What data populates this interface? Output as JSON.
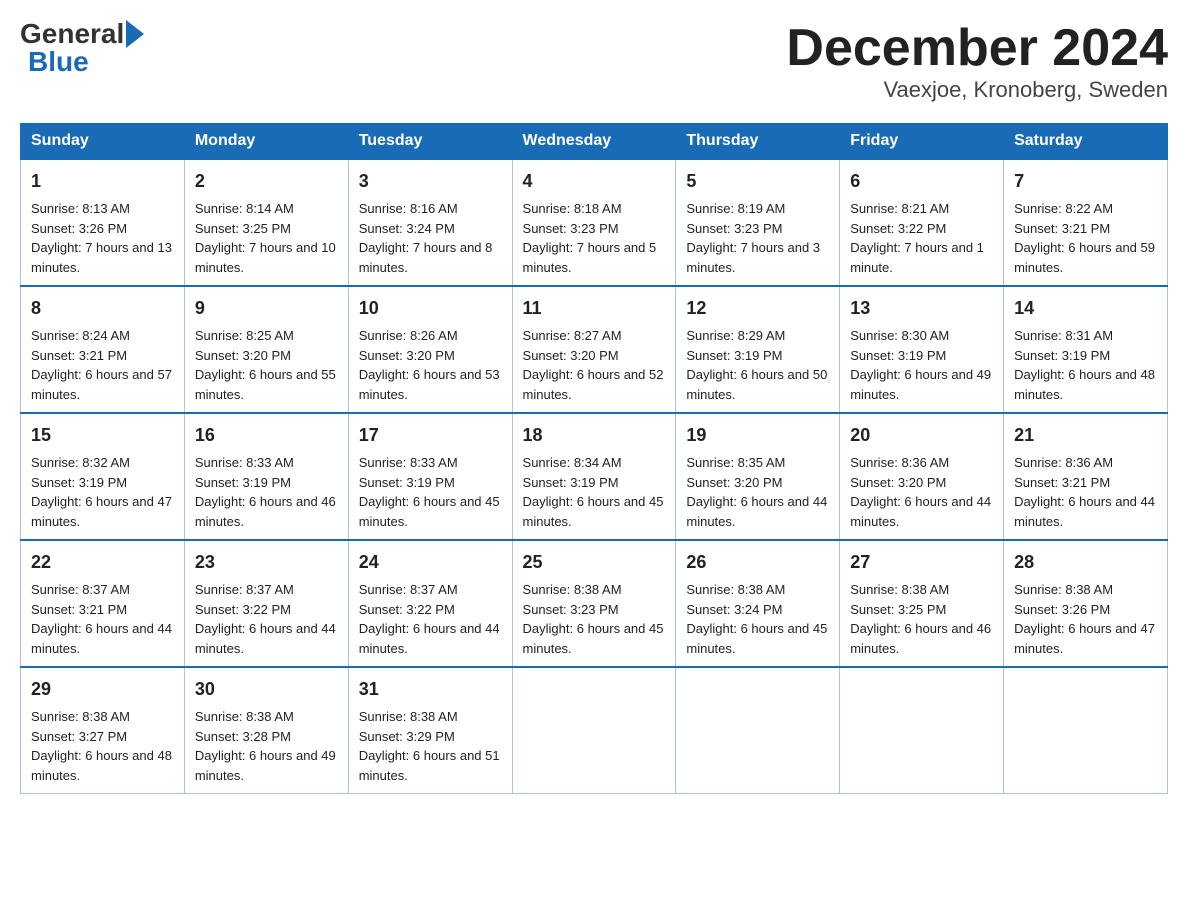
{
  "logo": {
    "general": "General",
    "blue": "Blue"
  },
  "title": "December 2024",
  "subtitle": "Vaexjoe, Kronoberg, Sweden",
  "days": [
    "Sunday",
    "Monday",
    "Tuesday",
    "Wednesday",
    "Thursday",
    "Friday",
    "Saturday"
  ],
  "weeks": [
    [
      {
        "num": "1",
        "sunrise": "8:13 AM",
        "sunset": "3:26 PM",
        "daylight": "7 hours and 13 minutes."
      },
      {
        "num": "2",
        "sunrise": "8:14 AM",
        "sunset": "3:25 PM",
        "daylight": "7 hours and 10 minutes."
      },
      {
        "num": "3",
        "sunrise": "8:16 AM",
        "sunset": "3:24 PM",
        "daylight": "7 hours and 8 minutes."
      },
      {
        "num": "4",
        "sunrise": "8:18 AM",
        "sunset": "3:23 PM",
        "daylight": "7 hours and 5 minutes."
      },
      {
        "num": "5",
        "sunrise": "8:19 AM",
        "sunset": "3:23 PM",
        "daylight": "7 hours and 3 minutes."
      },
      {
        "num": "6",
        "sunrise": "8:21 AM",
        "sunset": "3:22 PM",
        "daylight": "7 hours and 1 minute."
      },
      {
        "num": "7",
        "sunrise": "8:22 AM",
        "sunset": "3:21 PM",
        "daylight": "6 hours and 59 minutes."
      }
    ],
    [
      {
        "num": "8",
        "sunrise": "8:24 AM",
        "sunset": "3:21 PM",
        "daylight": "6 hours and 57 minutes."
      },
      {
        "num": "9",
        "sunrise": "8:25 AM",
        "sunset": "3:20 PM",
        "daylight": "6 hours and 55 minutes."
      },
      {
        "num": "10",
        "sunrise": "8:26 AM",
        "sunset": "3:20 PM",
        "daylight": "6 hours and 53 minutes."
      },
      {
        "num": "11",
        "sunrise": "8:27 AM",
        "sunset": "3:20 PM",
        "daylight": "6 hours and 52 minutes."
      },
      {
        "num": "12",
        "sunrise": "8:29 AM",
        "sunset": "3:19 PM",
        "daylight": "6 hours and 50 minutes."
      },
      {
        "num": "13",
        "sunrise": "8:30 AM",
        "sunset": "3:19 PM",
        "daylight": "6 hours and 49 minutes."
      },
      {
        "num": "14",
        "sunrise": "8:31 AM",
        "sunset": "3:19 PM",
        "daylight": "6 hours and 48 minutes."
      }
    ],
    [
      {
        "num": "15",
        "sunrise": "8:32 AM",
        "sunset": "3:19 PM",
        "daylight": "6 hours and 47 minutes."
      },
      {
        "num": "16",
        "sunrise": "8:33 AM",
        "sunset": "3:19 PM",
        "daylight": "6 hours and 46 minutes."
      },
      {
        "num": "17",
        "sunrise": "8:33 AM",
        "sunset": "3:19 PM",
        "daylight": "6 hours and 45 minutes."
      },
      {
        "num": "18",
        "sunrise": "8:34 AM",
        "sunset": "3:19 PM",
        "daylight": "6 hours and 45 minutes."
      },
      {
        "num": "19",
        "sunrise": "8:35 AM",
        "sunset": "3:20 PM",
        "daylight": "6 hours and 44 minutes."
      },
      {
        "num": "20",
        "sunrise": "8:36 AM",
        "sunset": "3:20 PM",
        "daylight": "6 hours and 44 minutes."
      },
      {
        "num": "21",
        "sunrise": "8:36 AM",
        "sunset": "3:21 PM",
        "daylight": "6 hours and 44 minutes."
      }
    ],
    [
      {
        "num": "22",
        "sunrise": "8:37 AM",
        "sunset": "3:21 PM",
        "daylight": "6 hours and 44 minutes."
      },
      {
        "num": "23",
        "sunrise": "8:37 AM",
        "sunset": "3:22 PM",
        "daylight": "6 hours and 44 minutes."
      },
      {
        "num": "24",
        "sunrise": "8:37 AM",
        "sunset": "3:22 PM",
        "daylight": "6 hours and 44 minutes."
      },
      {
        "num": "25",
        "sunrise": "8:38 AM",
        "sunset": "3:23 PM",
        "daylight": "6 hours and 45 minutes."
      },
      {
        "num": "26",
        "sunrise": "8:38 AM",
        "sunset": "3:24 PM",
        "daylight": "6 hours and 45 minutes."
      },
      {
        "num": "27",
        "sunrise": "8:38 AM",
        "sunset": "3:25 PM",
        "daylight": "6 hours and 46 minutes."
      },
      {
        "num": "28",
        "sunrise": "8:38 AM",
        "sunset": "3:26 PM",
        "daylight": "6 hours and 47 minutes."
      }
    ],
    [
      {
        "num": "29",
        "sunrise": "8:38 AM",
        "sunset": "3:27 PM",
        "daylight": "6 hours and 48 minutes."
      },
      {
        "num": "30",
        "sunrise": "8:38 AM",
        "sunset": "3:28 PM",
        "daylight": "6 hours and 49 minutes."
      },
      {
        "num": "31",
        "sunrise": "8:38 AM",
        "sunset": "3:29 PM",
        "daylight": "6 hours and 51 minutes."
      },
      null,
      null,
      null,
      null
    ]
  ]
}
